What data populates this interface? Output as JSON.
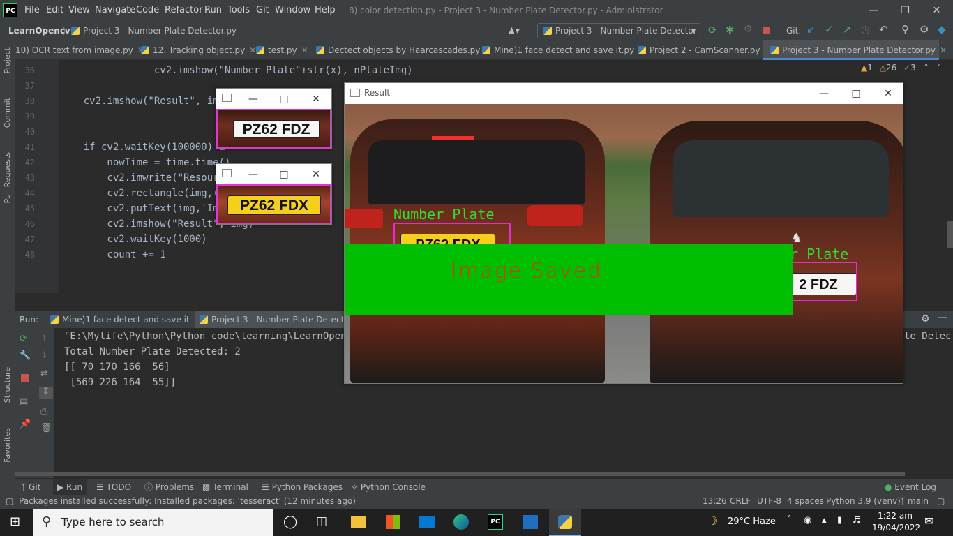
{
  "titlebar": {
    "logo": "PC",
    "menus": [
      "File",
      "Edit",
      "View",
      "Navigate",
      "Code",
      "Refactor",
      "Run",
      "Tools",
      "Git",
      "Window",
      "Help"
    ],
    "title": "8) color detection.py - Project 3 -  Number Plate Detector.py - Administrator"
  },
  "navbar": {
    "project": "LearnOpencv",
    "file": "Project 3 -  Number Plate Detector.py",
    "run_config": "Project 3 -  Number Plate Detector",
    "git_label": "Git:"
  },
  "tabs": [
    "10) OCR text from image.py",
    "12. Tracking object.py",
    "test.py",
    "Dectect objects by Haarcascades.py",
    "Mine)1 face detect and save it.py",
    "Project 2 - CamScanner.py",
    "Project 3 -  Number Plate Detector.py"
  ],
  "inspections": {
    "errors": "1",
    "warnings": "26",
    "weak": "3"
  },
  "left_tools": [
    "Project",
    "Commit",
    "Pull Requests",
    "Structure",
    "Favorites"
  ],
  "editor": {
    "lines": [
      {
        "n": "36",
        "t": "                cv2.imshow(\"Number Plate\"+str(x), nPlateImg)"
      },
      {
        "n": "37",
        "t": ""
      },
      {
        "n": "38",
        "t": "    cv2.imshow(\"Result\", img"
      },
      {
        "n": "39",
        "t": ""
      },
      {
        "n": "40",
        "t": ""
      },
      {
        "n": "41",
        "t": "    if cv2.waitKey(100000) &"
      },
      {
        "n": "42",
        "t": "        nowTime = time.time()"
      },
      {
        "n": "43",
        "t": "        cv2.imwrite(\"Resourc"
      },
      {
        "n": "44",
        "t": "        cv2.rectangle(img,(0"
      },
      {
        "n": "45",
        "t": "        cv2.putText(img,'Ima"
      },
      {
        "n": "46",
        "t": "        cv2.imshow(\"Result\", img)"
      },
      {
        "n": "47",
        "t": "        cv2.waitKey(1000)"
      },
      {
        "n": "48",
        "t": "        count += 1"
      }
    ]
  },
  "run": {
    "label": "Run:",
    "tabs": [
      "Mine)1 face detect and save it",
      "Project 3 -  Number Plate Detector"
    ],
    "output": [
      "\"E:\\Mylife\\Python\\Python code\\learning\\LearnOpencv",
      "Total Number Plate Detected: 2",
      "[[ 70 170 166  56]",
      " [569 226 164  55]]"
    ],
    "right_overflow": "te Detecto"
  },
  "bottom_tabs": [
    "Git",
    "Run",
    "TODO",
    "Problems",
    "Terminal",
    "Python Packages",
    "Python Console"
  ],
  "event_log": "Event Log",
  "status": {
    "message": "Packages installed successfully: Installed packages: 'tesseract' (12 minutes ago)",
    "position": "13:26",
    "line_sep": "CRLF",
    "encoding": "UTF-8",
    "indent": "4 spaces",
    "interpreter": "Python 3.9 (venv)",
    "branch": "main"
  },
  "plate_windows": [
    {
      "plate": "PZ62 FDZ"
    },
    {
      "plate": "PZ62 FDX"
    }
  ],
  "result_window": {
    "title": "Result",
    "label1": "Number Plate",
    "label2": "er Plate",
    "plate_left": "PZ62 FDX",
    "plate_right": "2 FDZ",
    "banner": "Image Saved"
  },
  "taskbar": {
    "search_placeholder": "Type here to search",
    "weather": "29°C  Haze",
    "time": "1:22 am",
    "date": "19/04/2022"
  }
}
